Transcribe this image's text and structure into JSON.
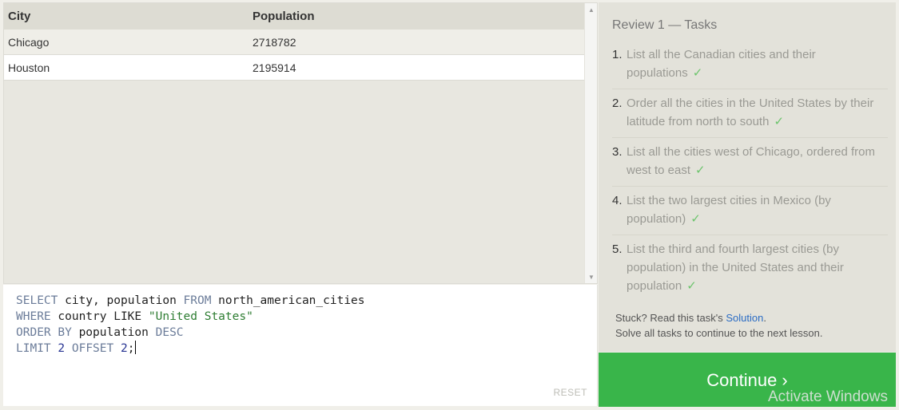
{
  "results": {
    "columns": [
      "City",
      "Population"
    ],
    "rows": [
      {
        "city": "Chicago",
        "population": "2718782"
      },
      {
        "city": "Houston",
        "population": "2195914"
      }
    ]
  },
  "editor": {
    "lines": [
      "SELECT city, population FROM north_american_cities",
      "WHERE country LIKE \"United States\"",
      "ORDER BY population DESC",
      "LIMIT 2 OFFSET 2;"
    ],
    "reset_label": "RESET"
  },
  "panel": {
    "title": "Review 1 — Tasks",
    "tasks": [
      {
        "num": "1.",
        "text": "List all the Canadian cities and their populations",
        "check": "✓"
      },
      {
        "num": "2.",
        "text": "Order all the cities in the United States by their latitude from north to south",
        "check": "✓"
      },
      {
        "num": "3.",
        "text": "List all the cities west of Chicago, ordered from west to east",
        "check": "✓"
      },
      {
        "num": "4.",
        "text": "List the two largest cities in Mexico (by population)",
        "check": "✓"
      },
      {
        "num": "5.",
        "text": "List the third and fourth largest cities (by population) in the United States and their population",
        "check": "✓"
      }
    ],
    "stuck_prefix": "Stuck? Read this task's ",
    "solution_link": "Solution",
    "stuck_suffix": ".",
    "solve_all": "Solve all tasks to continue to the next lesson.",
    "continue_label": "Continue ›"
  },
  "watermark": "Activate Windows",
  "colors": {
    "continue_bg": "#39b54a",
    "check": "#6cc46c",
    "link": "#2b6cc4"
  }
}
